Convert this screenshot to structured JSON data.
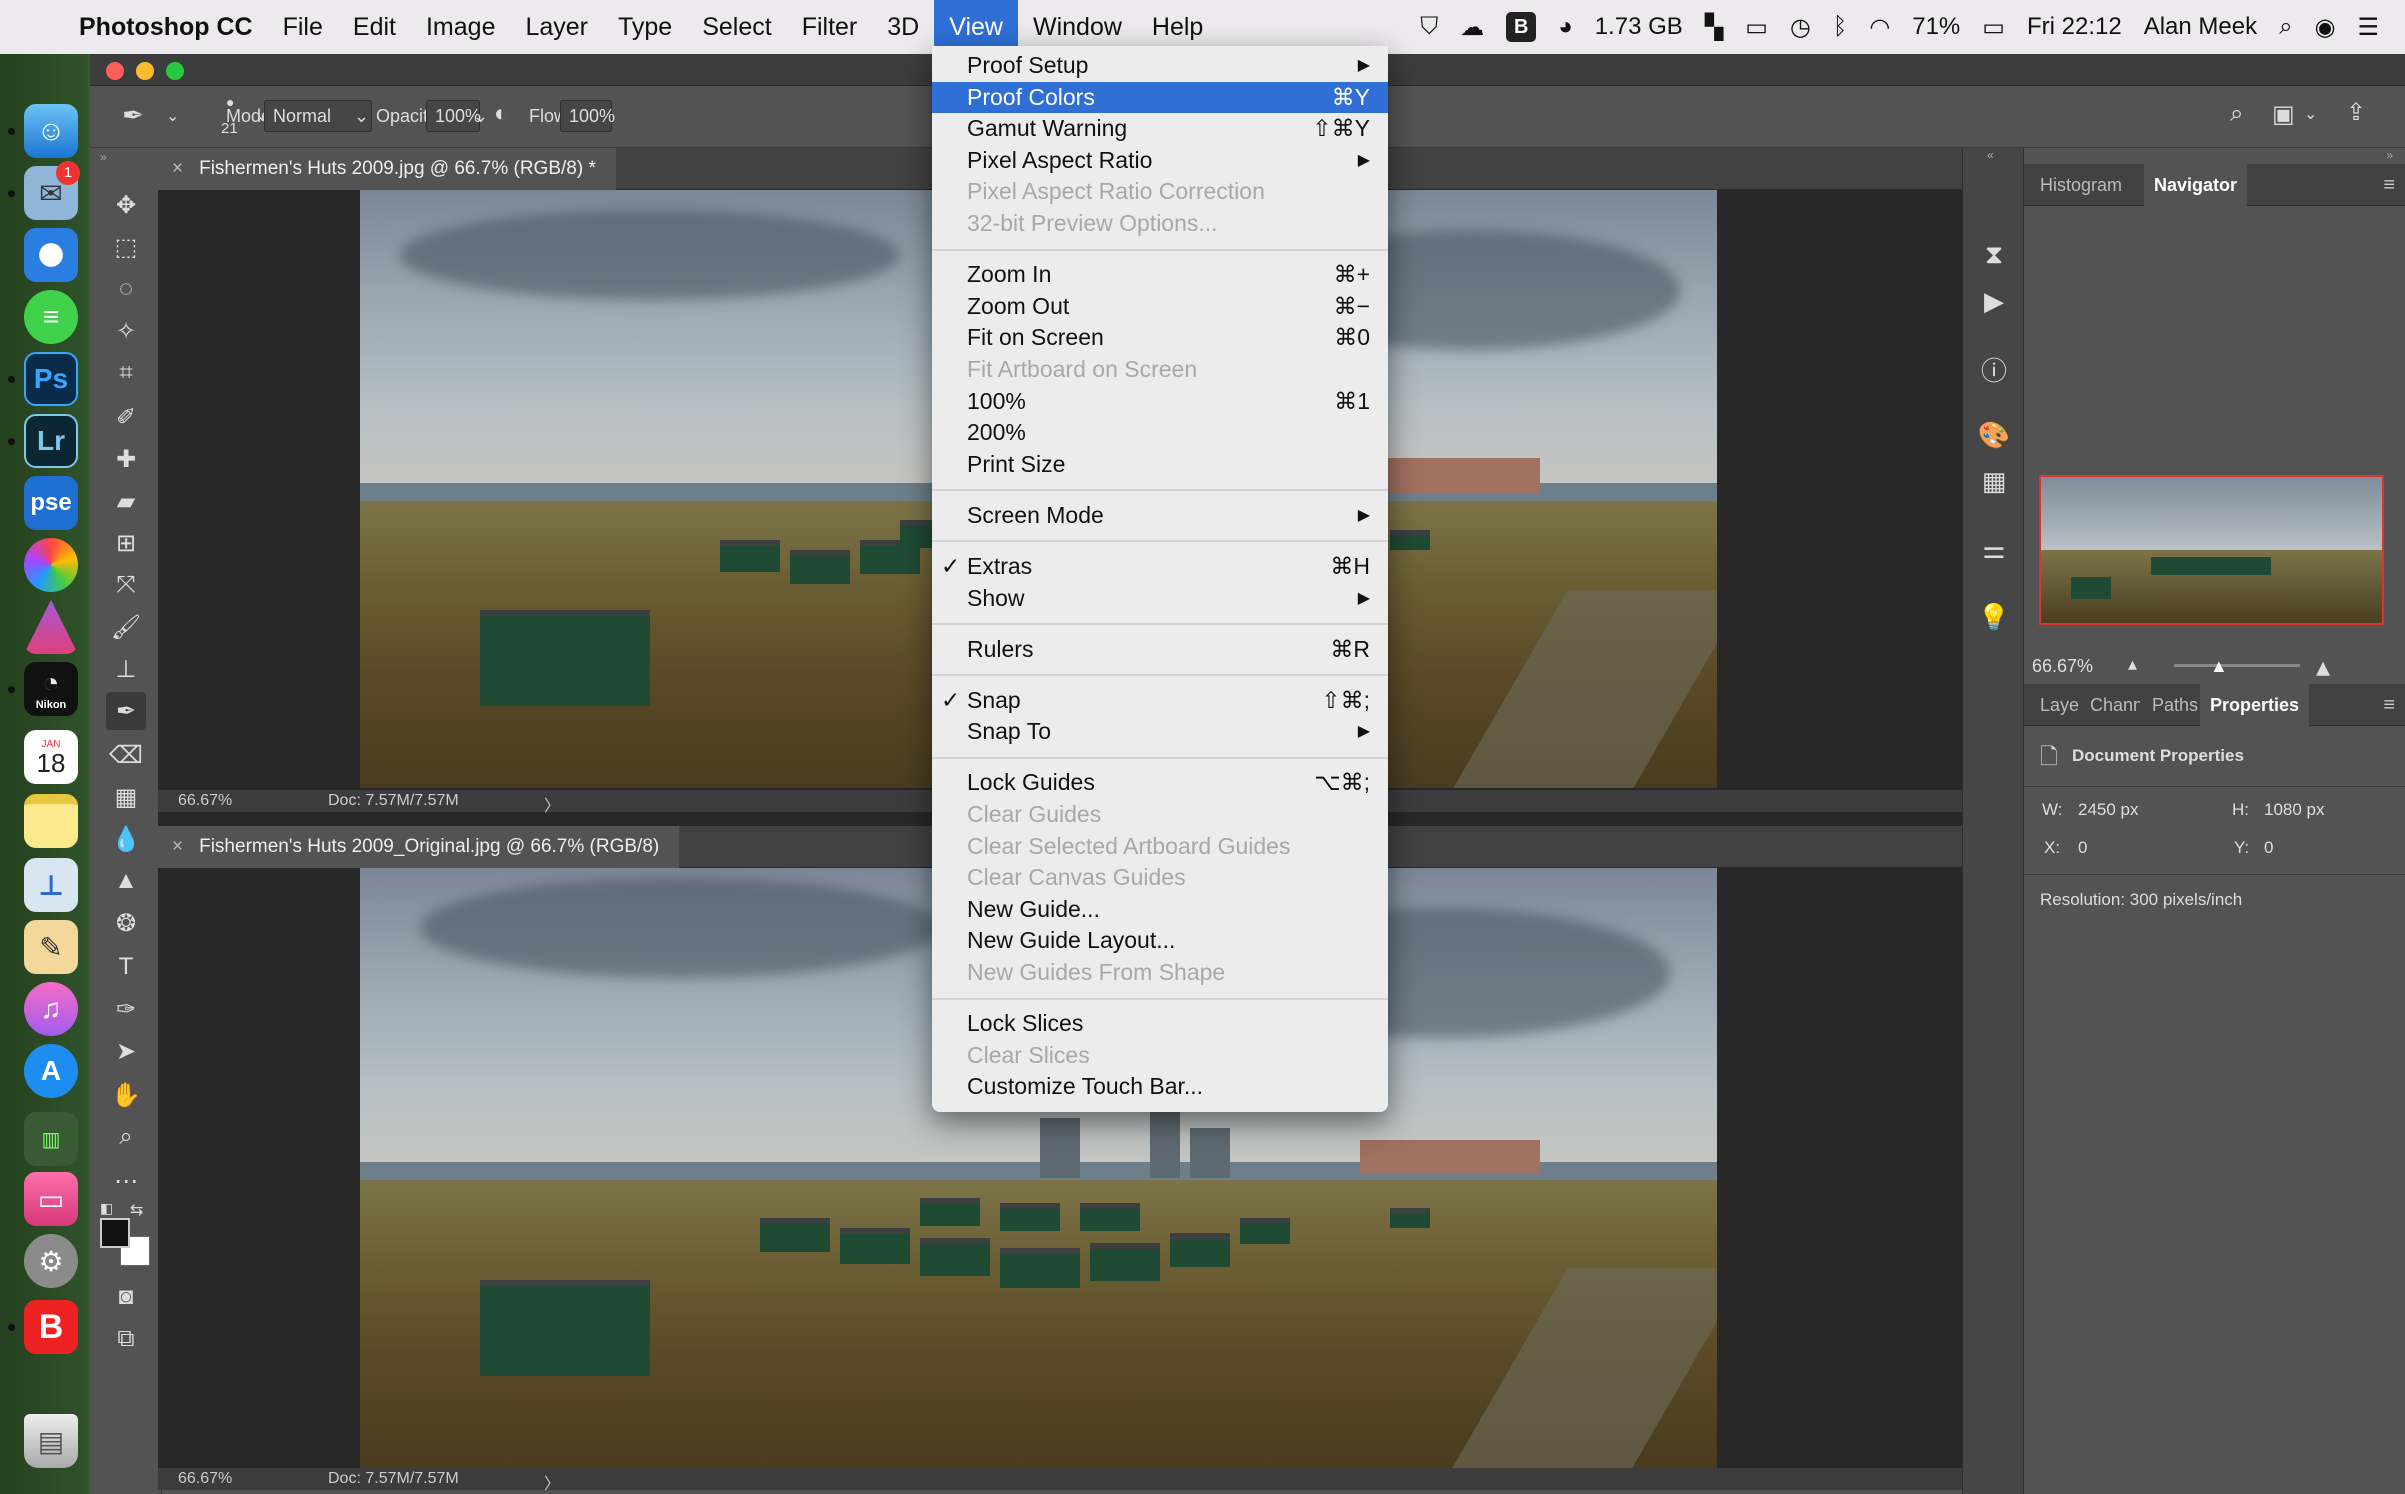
{
  "menubar": {
    "app_name": "Photoshop CC",
    "items": [
      "File",
      "Edit",
      "Image",
      "Layer",
      "Type",
      "Select",
      "Filter",
      "3D",
      "View",
      "Window",
      "Help"
    ],
    "memory": "1.73 GB",
    "battery": "71%",
    "clock": "Fri 22:12",
    "user": "Alan Meek"
  },
  "dock": {
    "mail_badge": "1",
    "ps_label": "Ps",
    "lr_label": "Lr",
    "pse_label": "pse",
    "calendar_month": "JAN",
    "calendar_day": "18",
    "nikon_label": "Nikon",
    "b_label": "B"
  },
  "options": {
    "brush_size": "21",
    "mode_label": "Mode:",
    "mode_value": "Normal",
    "opacity_label": "Opacity:",
    "opacity_value": "100%",
    "flow_label": "Flow:",
    "flow_value": "100%"
  },
  "documents": [
    {
      "tab_title": "Fishermen's Huts 2009.jpg @ 66.7% (RGB/8) *",
      "zoom": "66.67%",
      "doc_size": "Doc: 7.57M/7.57M"
    },
    {
      "tab_title": "Fishermen's Huts 2009_Original.jpg @ 66.7% (RGB/8)",
      "zoom": "66.67%",
      "doc_size": "Doc: 7.57M/7.57M"
    }
  ],
  "navigator": {
    "tabs": [
      "Histogram",
      "Navigator"
    ],
    "zoom": "66.67%"
  },
  "properties": {
    "tabs": [
      "Layers",
      "Channels",
      "Paths",
      "Properties"
    ],
    "title": "Document Properties",
    "w_label": "W:",
    "w_value": "2450 px",
    "h_label": "H:",
    "h_value": "1080 px",
    "x_label": "X:",
    "x_value": "0",
    "y_label": "Y:",
    "y_value": "0",
    "resolution": "Resolution: 300 pixels/inch"
  },
  "view_menu": {
    "items": [
      {
        "label": "Proof Setup",
        "shortcut": "▶",
        "enabled": true
      },
      {
        "label": "Proof Colors",
        "shortcut": "⌘Y",
        "enabled": true,
        "highlighted": true
      },
      {
        "label": "Gamut Warning",
        "shortcut": "⇧⌘Y",
        "enabled": true
      },
      {
        "label": "Pixel Aspect Ratio",
        "shortcut": "▶",
        "enabled": true
      },
      {
        "label": "Pixel Aspect Ratio Correction",
        "shortcut": "",
        "enabled": false
      },
      {
        "label": "32-bit Preview Options...",
        "shortcut": "",
        "enabled": false
      },
      {
        "label": "Zoom In",
        "shortcut": "⌘+",
        "enabled": true
      },
      {
        "label": "Zoom Out",
        "shortcut": "⌘−",
        "enabled": true
      },
      {
        "label": "Fit on Screen",
        "shortcut": "⌘0",
        "enabled": true
      },
      {
        "label": "Fit Artboard on Screen",
        "shortcut": "",
        "enabled": false
      },
      {
        "label": "100%",
        "shortcut": "⌘1",
        "enabled": true
      },
      {
        "label": "200%",
        "shortcut": "",
        "enabled": true
      },
      {
        "label": "Print Size",
        "shortcut": "",
        "enabled": true
      },
      {
        "label": "Screen Mode",
        "shortcut": "▶",
        "enabled": true
      },
      {
        "label": "Extras",
        "shortcut": "⌘H",
        "enabled": true,
        "checked": true
      },
      {
        "label": "Show",
        "shortcut": "▶",
        "enabled": true
      },
      {
        "label": "Rulers",
        "shortcut": "⌘R",
        "enabled": true
      },
      {
        "label": "Snap",
        "shortcut": "⇧⌘;",
        "enabled": true,
        "checked": true
      },
      {
        "label": "Snap To",
        "shortcut": "▶",
        "enabled": true
      },
      {
        "label": "Lock Guides",
        "shortcut": "⌥⌘;",
        "enabled": true
      },
      {
        "label": "Clear Guides",
        "shortcut": "",
        "enabled": false
      },
      {
        "label": "Clear Selected Artboard Guides",
        "shortcut": "",
        "enabled": false
      },
      {
        "label": "Clear Canvas Guides",
        "shortcut": "",
        "enabled": false
      },
      {
        "label": "New Guide...",
        "shortcut": "",
        "enabled": true
      },
      {
        "label": "New Guide Layout...",
        "shortcut": "",
        "enabled": true
      },
      {
        "label": "New Guides From Shape",
        "shortcut": "",
        "enabled": false
      },
      {
        "label": "Lock Slices",
        "shortcut": "",
        "enabled": true
      },
      {
        "label": "Clear Slices",
        "shortcut": "",
        "enabled": false
      },
      {
        "label": "Customize Touch Bar...",
        "shortcut": "",
        "enabled": true
      }
    ],
    "check_mark": "✓"
  },
  "colors": {
    "menu_highlight": "#2f6fd6",
    "ps_bg": "#535353",
    "hut_green": "#1f4a33"
  }
}
